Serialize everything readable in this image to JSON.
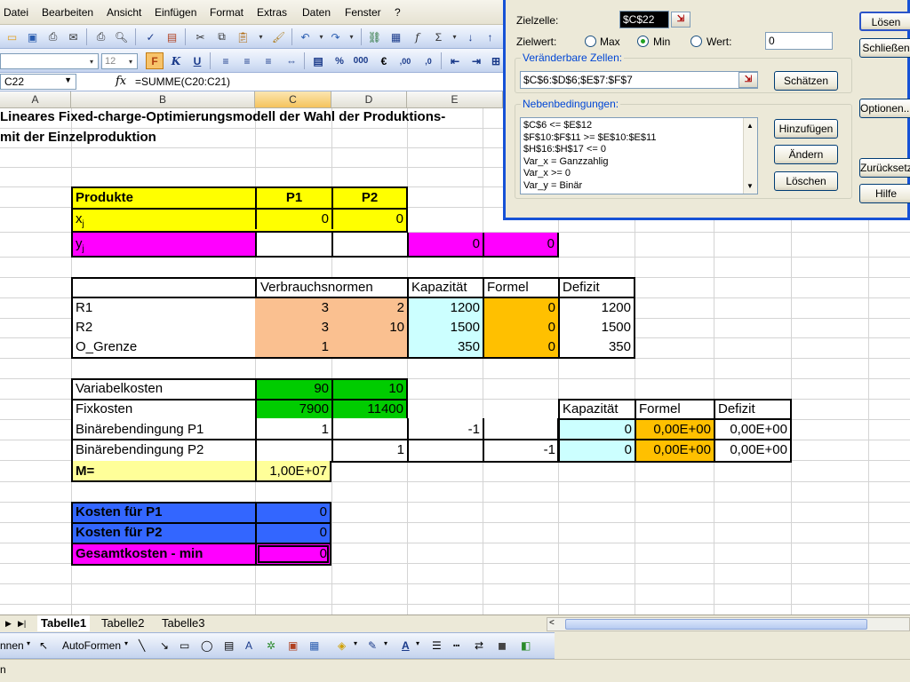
{
  "menu": [
    "Datei",
    "Bearbeiten",
    "Ansicht",
    "Einfügen",
    "Format",
    "Extras",
    "Daten",
    "Fenster",
    "?"
  ],
  "font_size": "12",
  "namebox": "C22",
  "fx_label": "fx",
  "formula": "=SUMME(C20:C21)",
  "columns": [
    "A",
    "B",
    "C",
    "D",
    "E"
  ],
  "title_line1": "Lineares Fixed-charge-Optimierungsmodell der Wahl der Produktions-",
  "title_line2": "mit der Einzelproduktion",
  "produkte": {
    "header": "Produkte",
    "p1": "P1",
    "p2": "P2",
    "x_label": "x",
    "x_sub": "j",
    "x_p1": "0",
    "x_p2": "0",
    "y_label": "y",
    "y_sub": "j",
    "y_e": "0",
    "y_f": "0"
  },
  "normen": {
    "header": "Verbrauchsnormen",
    "kap": "Kapazität",
    "formel": "Formel",
    "defizit": "Defizit",
    "rows": [
      {
        "name": "R1",
        "c": "3",
        "d": "2",
        "kap": "1200",
        "formel": "0",
        "defizit": "1200"
      },
      {
        "name": "R2",
        "c": "3",
        "d": "10",
        "kap": "1500",
        "formel": "0",
        "defizit": "1500"
      },
      {
        "name": "O_Grenze",
        "c": "1",
        "d": "",
        "kap": "350",
        "formel": "0",
        "defizit": "350"
      }
    ]
  },
  "kosten": {
    "var_label": "Variabelkosten",
    "var_c": "90",
    "var_d": "10",
    "fix_label": "Fixkosten",
    "fix_c": "7900",
    "fix_d": "11400",
    "bin1_label": "Binärebendingung P1",
    "bin1_c": "1",
    "bin1_e": "-1",
    "bin2_label": "Binärebendingung P2",
    "bin2_d": "1",
    "bin2_f": "-1",
    "m_label": "M=",
    "m_val": "1,00E+07",
    "kap_header": "Kapazität",
    "formel_header": "Formel",
    "defizit_header": "Defizit",
    "b1_kap": "0",
    "b1_formel": "0,00E+00",
    "b1_def": "0,00E+00",
    "b2_kap": "0",
    "b2_formel": "0,00E+00",
    "b2_def": "0,00E+00"
  },
  "ergebnis": {
    "k1_label": "Kosten für P1",
    "k1": "0",
    "k2_label": "Kosten für P2",
    "k2": "0",
    "gk_label": "Gesamtkosten - min",
    "gk": "0"
  },
  "sheets": [
    "Tabelle1",
    "Tabelle2",
    "Tabelle3"
  ],
  "drawbar": {
    "menu": "nnen",
    "autoformen": "AutoFormen"
  },
  "status": "n",
  "solver": {
    "zielzelle_label": "Zielzelle:",
    "zielzelle": "$C$22",
    "zielwert_label": "Zielwert:",
    "max": "Max",
    "min": "Min",
    "wert": "Wert:",
    "wert_value": "0",
    "selected": "min",
    "veraenderbar_label": "Veränderbare Zellen:",
    "veraenderbar": "$C$6:$D$6;$E$7:$F$7",
    "schaetzen": "Schätzen",
    "neben_label": "Nebenbedingungen:",
    "constraints": [
      "$C$6 <= $E$12",
      "$F$10:$F$11 >= $E$10:$E$11",
      "$H$16:$H$17 <= 0",
      "Var_x = Ganzzahlig",
      "Var_x >= 0",
      "Var_y = Binär"
    ],
    "hinzufuegen": "Hinzufügen",
    "aendern": "Ändern",
    "loeschen": "Löschen",
    "loesen": "Lösen",
    "schliessen": "Schließen",
    "optionen": "Optionen...",
    "zuruecksetzen": "Zurücksetzen",
    "hilfe": "Hilfe"
  },
  "colors": {
    "yellow": "#ffff00",
    "magenta": "#ff00ff",
    "peach": "#fac090",
    "cyan": "#ccffff",
    "orange": "#ffc000",
    "green": "#00cc00",
    "blue": "#3366ff",
    "lightyellow": "#ffff99"
  }
}
